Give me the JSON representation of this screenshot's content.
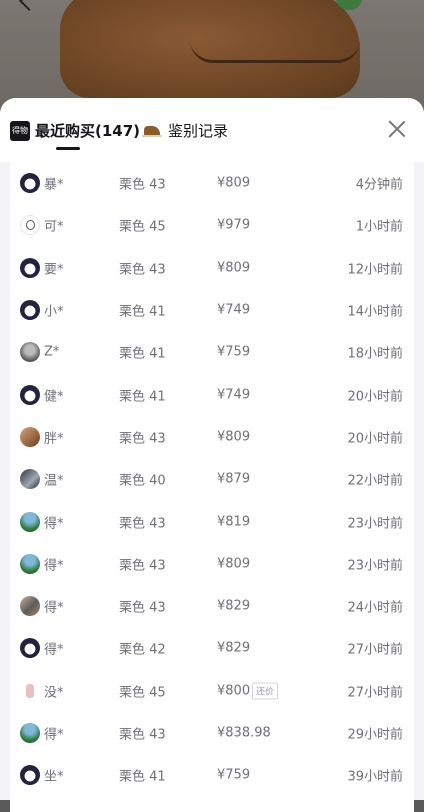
{
  "sheet": {
    "tabs": [
      {
        "label": "最近购买(147)",
        "icon": "dewu-logo-icon",
        "active": true
      },
      {
        "label": "鉴别记录",
        "icon": "shoe-icon",
        "active": false
      }
    ]
  },
  "purchases": [
    {
      "avatar": "panda",
      "name": "暴*",
      "spec": "栗色 43",
      "price": "¥809",
      "tag": "",
      "time": "4分钟前"
    },
    {
      "avatar": "white",
      "name": "可*",
      "spec": "栗色 45",
      "price": "¥979",
      "tag": "",
      "time": "1小时前"
    },
    {
      "avatar": "panda",
      "name": "要*",
      "spec": "栗色 43",
      "price": "¥809",
      "tag": "",
      "time": "12小时前"
    },
    {
      "avatar": "panda",
      "name": "小*",
      "spec": "栗色 41",
      "price": "¥749",
      "tag": "",
      "time": "14小时前"
    },
    {
      "avatar": "gray",
      "name": "Z*",
      "spec": "栗色 41",
      "price": "¥759",
      "tag": "",
      "time": "18小时前"
    },
    {
      "avatar": "panda",
      "name": "健*",
      "spec": "栗色 41",
      "price": "¥749",
      "tag": "",
      "time": "20小时前"
    },
    {
      "avatar": "photo",
      "name": "胖*",
      "spec": "栗色 43",
      "price": "¥809",
      "tag": "",
      "time": "20小时前"
    },
    {
      "avatar": "dark",
      "name": "温*",
      "spec": "栗色 40",
      "price": "¥879",
      "tag": "",
      "time": "22小时前"
    },
    {
      "avatar": "green",
      "name": "得*",
      "spec": "栗色 43",
      "price": "¥819",
      "tag": "",
      "time": "23小时前"
    },
    {
      "avatar": "green",
      "name": "得*",
      "spec": "栗色 43",
      "price": "¥809",
      "tag": "",
      "time": "23小时前"
    },
    {
      "avatar": "mixed",
      "name": "得*",
      "spec": "栗色 43",
      "price": "¥829",
      "tag": "",
      "time": "24小时前"
    },
    {
      "avatar": "panda",
      "name": "得*",
      "spec": "栗色 42",
      "price": "¥829",
      "tag": "",
      "time": "27小时前"
    },
    {
      "avatar": "pink",
      "name": "没*",
      "spec": "栗色 45",
      "price": "¥800",
      "tag": "还价",
      "time": "27小时前"
    },
    {
      "avatar": "green",
      "name": "得*",
      "spec": "栗色 43",
      "price": "¥838.98",
      "tag": "",
      "time": "29小时前"
    },
    {
      "avatar": "panda",
      "name": "坐*",
      "spec": "栗色 41",
      "price": "¥759",
      "tag": "",
      "time": "39小时前"
    }
  ]
}
